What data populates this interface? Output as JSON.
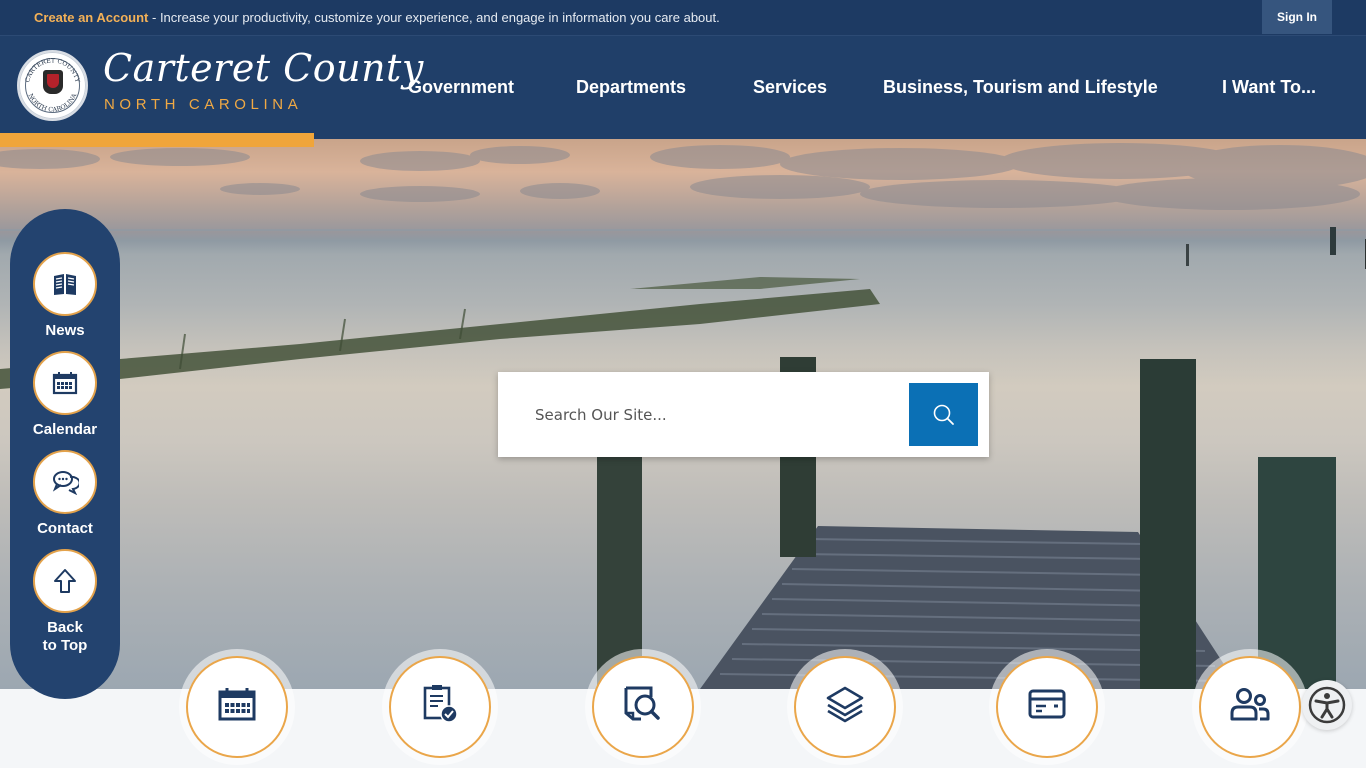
{
  "topbar": {
    "create_account_label": "Create an Account",
    "message": " - Increase your productivity, customize your experience, and engage in information you care about.",
    "sign_in_label": "Sign In"
  },
  "brand": {
    "title": "Carteret County",
    "subtitle": "NORTH CAROLINA",
    "seal_text_top": "CARTERET COUNTY",
    "seal_text_bottom": "NORTH CAROLINA"
  },
  "nav": {
    "items": [
      {
        "label": "Government"
      },
      {
        "label": "Departments"
      },
      {
        "label": "Services"
      },
      {
        "label": "Business, Tourism and Lifestyle"
      },
      {
        "label": "I Want To..."
      }
    ]
  },
  "search": {
    "placeholder": "Search Our Site...",
    "value": "",
    "button_icon": "search-icon"
  },
  "quick_links": [
    {
      "label": "News",
      "icon": "newspaper-icon"
    },
    {
      "label": "Calendar",
      "icon": "calendar-icon"
    },
    {
      "label": "Contact",
      "icon": "chat-bubbles-icon"
    },
    {
      "label_line1": "Back",
      "label_line2": "to Top",
      "icon": "arrow-up-icon"
    }
  ],
  "feature_icons": [
    {
      "icon": "calendar-icon"
    },
    {
      "icon": "clipboard-check-icon"
    },
    {
      "icon": "document-search-icon"
    },
    {
      "icon": "layers-icon"
    },
    {
      "icon": "credit-card-icon"
    },
    {
      "icon": "users-icon"
    }
  ],
  "colors": {
    "navy": "#203f69",
    "topbar": "#1d3a63",
    "accent_orange": "#f0a53a",
    "search_blue": "#0b70b5",
    "icon_navy": "#1e3a62"
  },
  "accessibility": {
    "icon": "accessibility-icon"
  }
}
